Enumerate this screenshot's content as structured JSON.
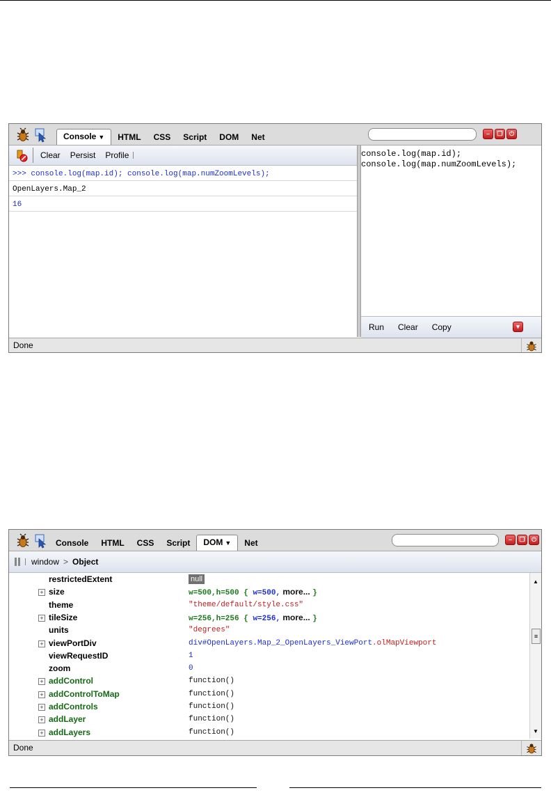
{
  "toolbar_tabs": [
    "Console",
    "HTML",
    "CSS",
    "Script",
    "DOM",
    "Net"
  ],
  "console_panel": {
    "active_tab": "Console",
    "subbar": [
      "Clear",
      "Persist",
      "Profile"
    ],
    "command": ">>> console.log(map.id); console.log(map.numZoomLevels);",
    "outputs": [
      "OpenLayers.Map_2",
      "16"
    ],
    "editor_lines": [
      "console.log(map.id);",
      "console.log(map.numZoomLevels);"
    ],
    "editor_buttons": [
      "Run",
      "Clear",
      "Copy"
    ],
    "status": "Done"
  },
  "dom_panel": {
    "active_tab": "DOM",
    "breadcrumb": {
      "root": "window",
      "sep": ">",
      "current": "Object"
    },
    "rows": [
      {
        "key": "restrictedExtent",
        "value": "null",
        "kind": "null",
        "expandable": false,
        "fn": false
      },
      {
        "key": "size",
        "value": "w=500,h=500",
        "preview": [
          "{ ",
          "w=500,",
          " more... ",
          "}"
        ],
        "kind": "obj",
        "expandable": true,
        "fn": false
      },
      {
        "key": "theme",
        "value": "\"theme/default/style.css\"",
        "kind": "string",
        "expandable": false,
        "fn": false
      },
      {
        "key": "tileSize",
        "value": "w=256,h=256",
        "preview": [
          "{ ",
          "w=256,",
          " more... ",
          "}"
        ],
        "kind": "obj",
        "expandable": true,
        "fn": false
      },
      {
        "key": "units",
        "value": "\"degrees\"",
        "kind": "string",
        "expandable": false,
        "fn": false
      },
      {
        "key": "viewPortDiv",
        "value": "div#OpenLayers.Map_2_OpenLayers_ViewPort",
        "value_class": ".olMapViewport",
        "kind": "element",
        "expandable": true,
        "fn": false
      },
      {
        "key": "viewRequestID",
        "value": "1",
        "kind": "number",
        "expandable": false,
        "fn": false
      },
      {
        "key": "zoom",
        "value": "0",
        "kind": "number",
        "expandable": false,
        "fn": false
      },
      {
        "key": "addControl",
        "value": "function()",
        "kind": "function",
        "expandable": true,
        "fn": true
      },
      {
        "key": "addControlToMap",
        "value": "function()",
        "kind": "function",
        "expandable": true,
        "fn": true
      },
      {
        "key": "addControls",
        "value": "function()",
        "kind": "function",
        "expandable": true,
        "fn": true
      },
      {
        "key": "addLayer",
        "value": "function()",
        "kind": "function",
        "expandable": true,
        "fn": true
      },
      {
        "key": "addLayers",
        "value": "function()",
        "kind": "function",
        "expandable": true,
        "fn": true
      }
    ],
    "status": "Done"
  },
  "colors": {
    "command": "#1d2fcf",
    "number": "#1d2fcf",
    "string": "#c81c1c",
    "obj": "#1c7a1c",
    "fn_key": "#146a14"
  }
}
